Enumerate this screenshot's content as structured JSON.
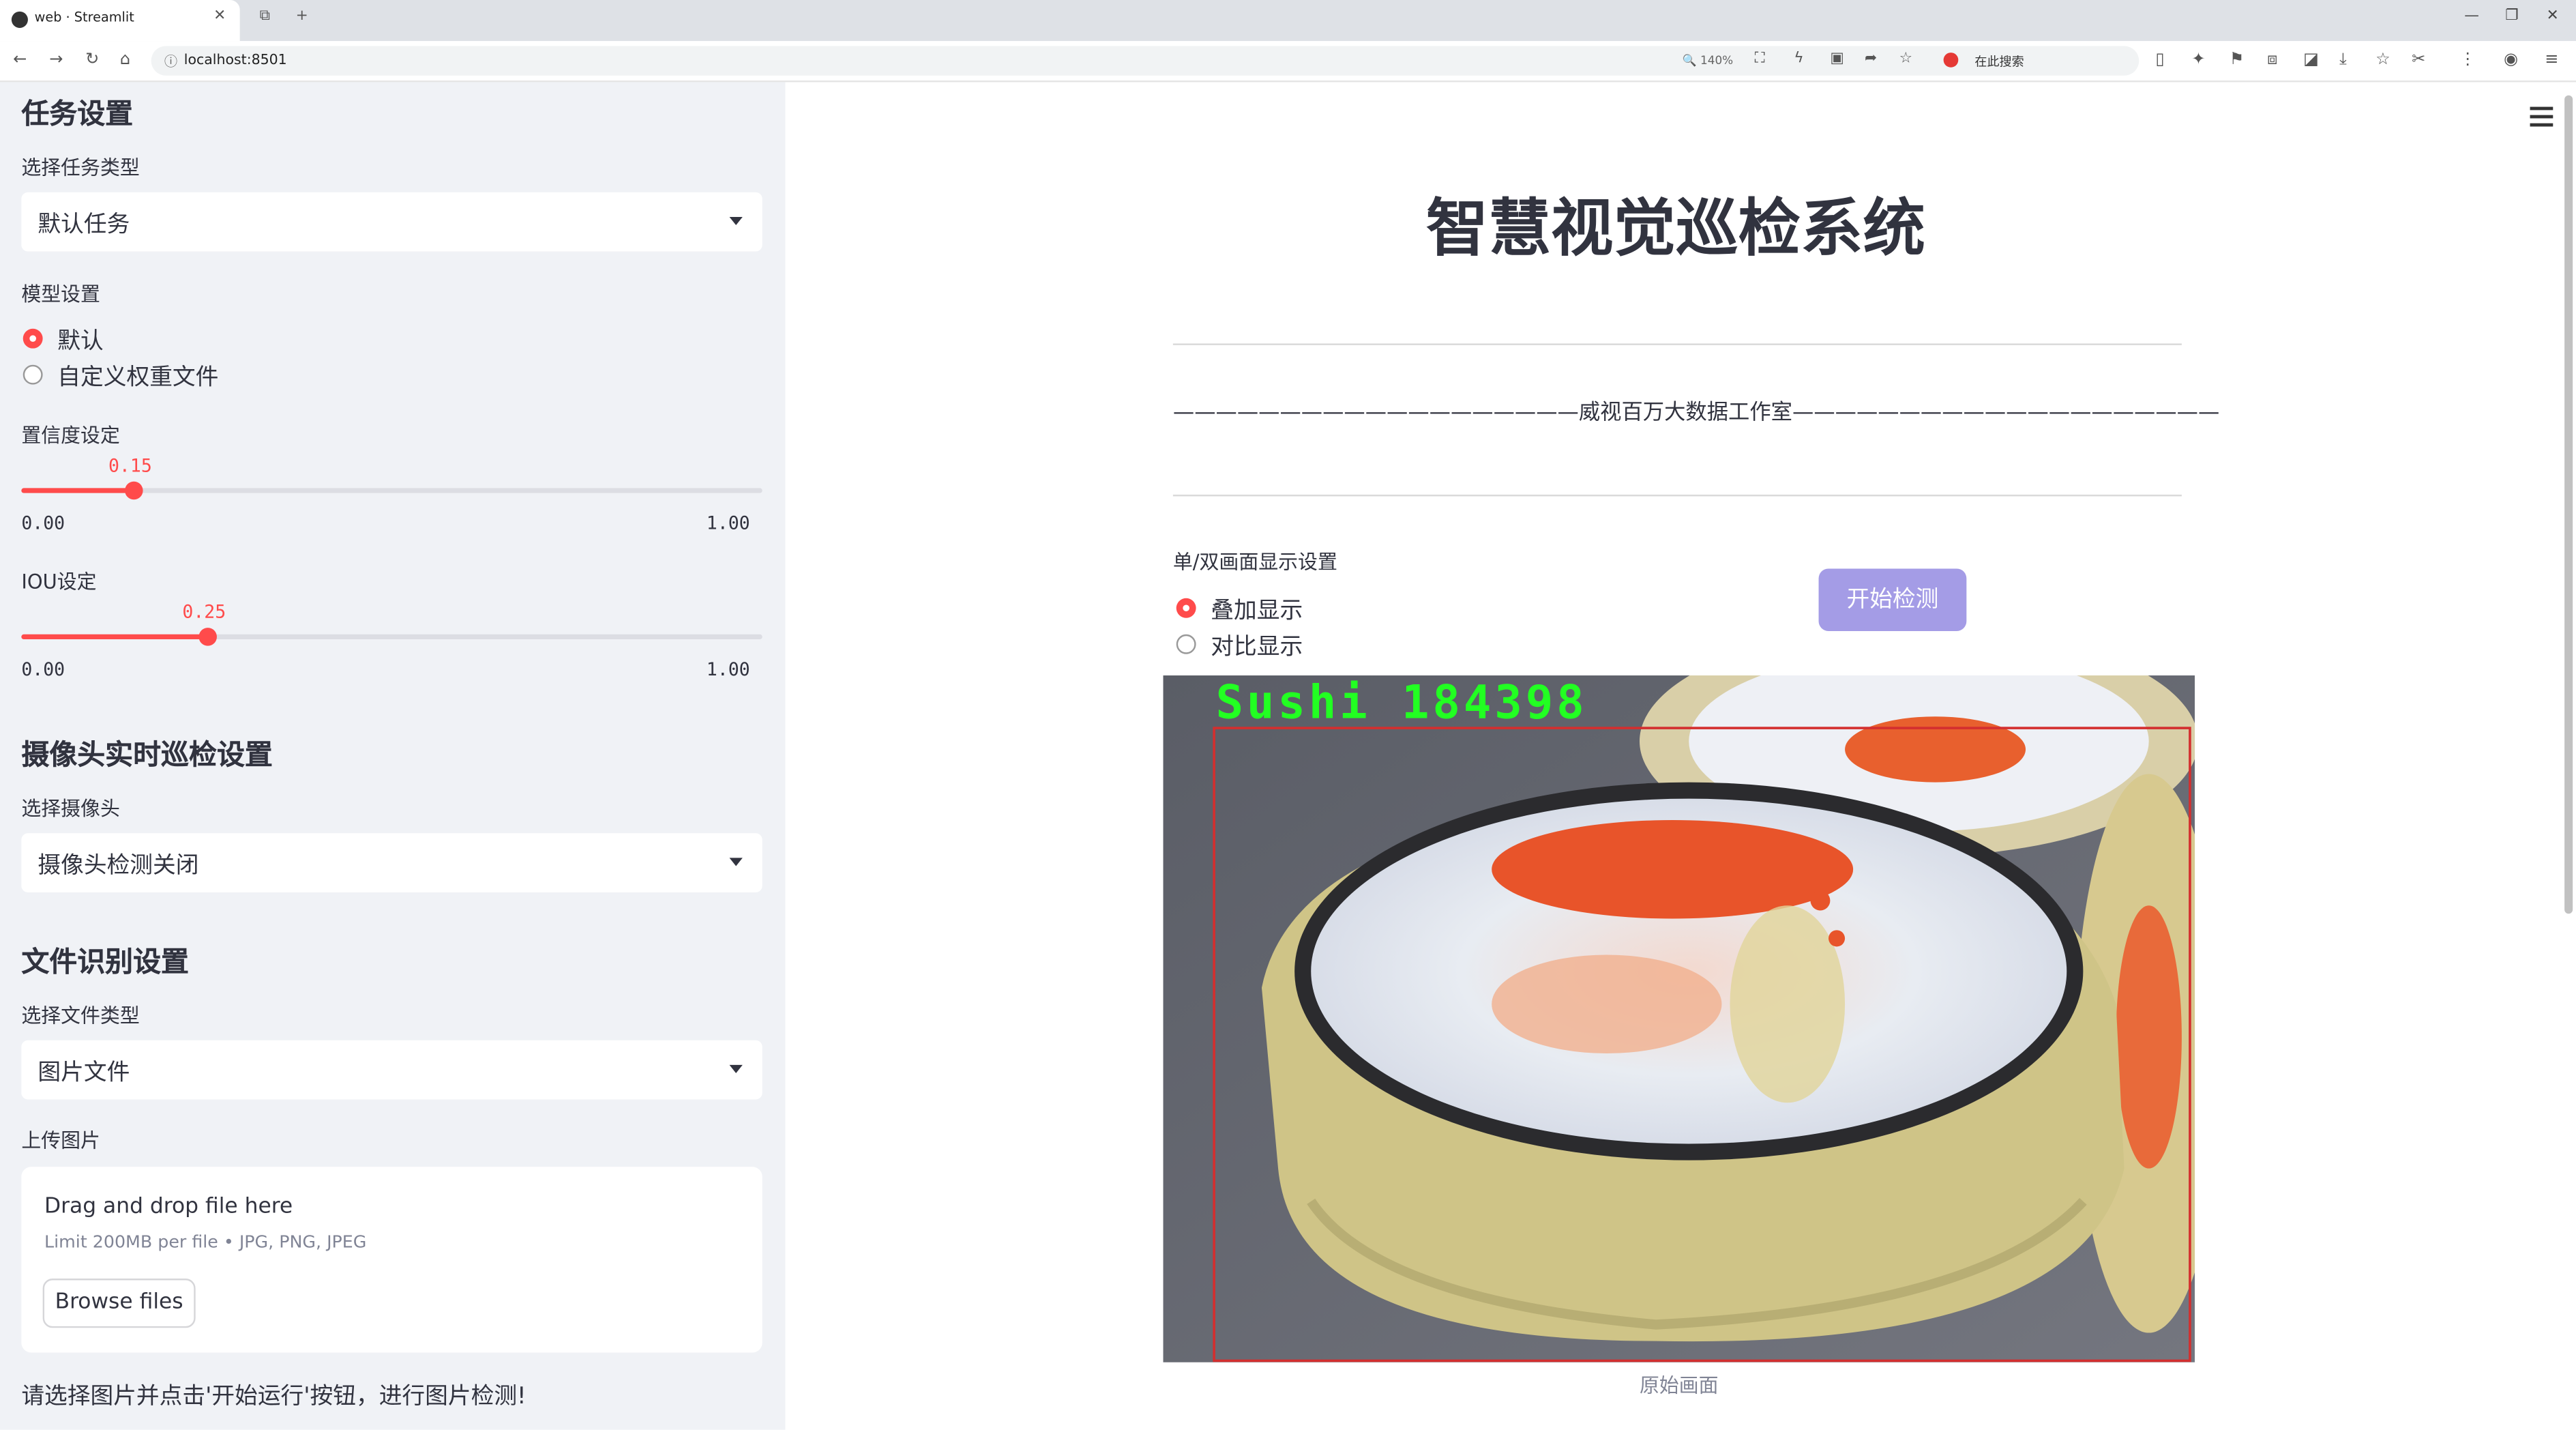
{
  "browser": {
    "tab_title": "web · Streamlit",
    "url": "localhost:8501",
    "zoom": "140%",
    "search_text": "在此搜索"
  },
  "sidebar": {
    "task_section_title": "任务设置",
    "task_type_label": "选择任务类型",
    "task_type_value": "默认任务",
    "model_label": "模型设置",
    "model_options": [
      "默认",
      "自定义权重文件"
    ],
    "model_selected": "默认",
    "conf_label": "置信度设定",
    "conf_value": "0.15",
    "conf_min": "0.00",
    "conf_max": "1.00",
    "iou_label": "IOU设定",
    "iou_value": "0.25",
    "iou_min": "0.00",
    "iou_max": "1.00",
    "camera_section_title": "摄像头实时巡检设置",
    "camera_label": "选择摄像头",
    "camera_value": "摄像头检测关闭",
    "file_section_title": "文件识别设置",
    "file_type_label": "选择文件类型",
    "file_type_value": "图片文件",
    "upload_label": "上传图片",
    "upload_drag": "Drag and drop file here",
    "upload_limit": "Limit 200MB per file • JPG, PNG, JPEG",
    "browse_button": "Browse files",
    "note": "请选择图片并点击'开始运行'按钮，进行图片检测!"
  },
  "main": {
    "title": "智慧视觉巡检系统",
    "banner": "———————————————————威视百万大数据工作室————————————————————",
    "display_label": "单/双画面显示设置",
    "display_options": [
      "叠加显示",
      "对比显示"
    ],
    "display_selected": "叠加显示",
    "start_button": "开始检测",
    "detection_label": "Sushi 184398",
    "caption": "原始画面"
  },
  "colors": {
    "accent": "#ff4b4b",
    "button": "#a49ce6",
    "sidebar_bg": "#f0f2f6",
    "box": "#d32f2f",
    "detect_text": "#22ff22"
  }
}
